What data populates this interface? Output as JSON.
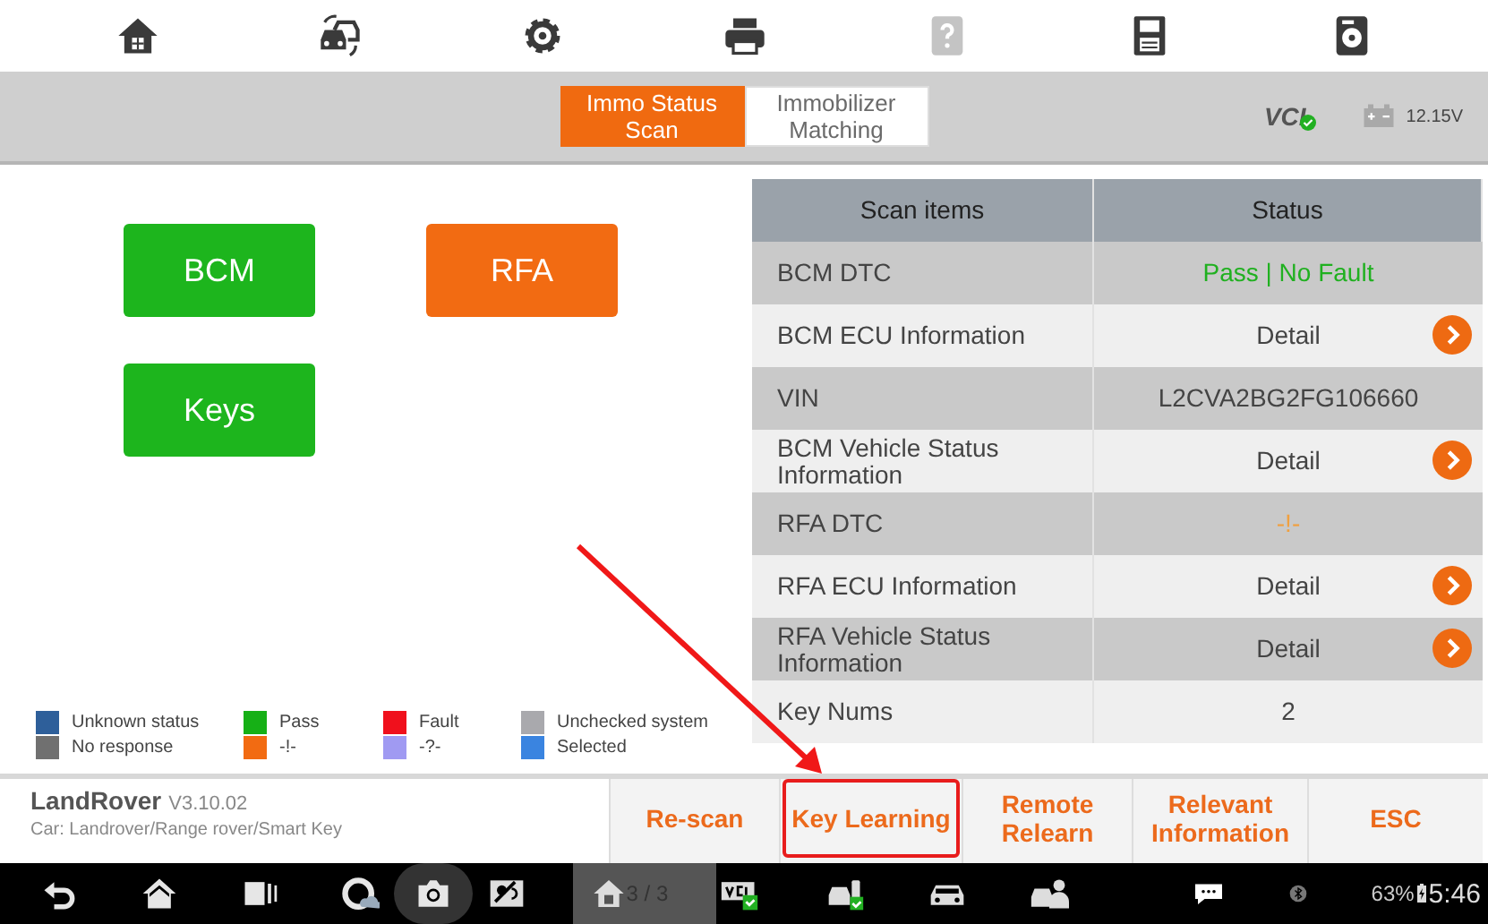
{
  "toolbar": [
    {
      "kind": "home",
      "disabled": false
    },
    {
      "kind": "cars",
      "disabled": false
    },
    {
      "kind": "gear",
      "disabled": false
    },
    {
      "kind": "printer",
      "disabled": false
    },
    {
      "kind": "help",
      "disabled": true
    },
    {
      "kind": "save",
      "disabled": false
    },
    {
      "kind": "disk",
      "disabled": false
    }
  ],
  "tabs": [
    {
      "label": "Immo Status Scan",
      "selected": true
    },
    {
      "label": "Immobilizer Matching",
      "selected": false
    }
  ],
  "vci": {
    "label": "VCI",
    "connected": true
  },
  "battery": {
    "reading": "12.15V"
  },
  "modules": [
    {
      "label": "BCM",
      "color": "#1db51d"
    },
    {
      "label": "RFA",
      "color": "#f26b12"
    },
    {
      "label": "Keys",
      "color": "#1db51d"
    }
  ],
  "legend": [
    {
      "label": "Unknown status",
      "color": "#2e5f9a"
    },
    {
      "label": "Pass",
      "color": "#16b016"
    },
    {
      "label": "Fault",
      "color": "#f0101c"
    },
    {
      "label": "Unchecked system",
      "color": "#a9a9ad"
    },
    {
      "label": "No response",
      "color": "#707070"
    },
    {
      "label": "-!-",
      "color": "#f26b12"
    },
    {
      "label": "-?-",
      "color": "#a09af2"
    },
    {
      "label": "Selected",
      "color": "#3a84e0"
    }
  ],
  "table": {
    "columns": [
      "Scan items",
      "Status"
    ],
    "rows": [
      {
        "item": "BCM DTC",
        "status": "Pass | No Fault",
        "kind": "pass"
      },
      {
        "item": "BCM ECU Information",
        "status": "Detail",
        "kind": "detail"
      },
      {
        "item": "VIN",
        "status": "L2CVA2BG2FG106660",
        "kind": "plain"
      },
      {
        "item": "BCM Vehicle Status Information",
        "status": "Detail",
        "kind": "detail"
      },
      {
        "item": "RFA DTC",
        "status": "-!-",
        "kind": "warning"
      },
      {
        "item": "RFA ECU Information",
        "status": "Detail",
        "kind": "detail"
      },
      {
        "item": "RFA Vehicle Status Information",
        "status": "Detail",
        "kind": "detail"
      },
      {
        "item": "Key Nums",
        "status": "2",
        "kind": "plain"
      }
    ]
  },
  "info": {
    "brand": "LandRover",
    "version": "V3.10.02",
    "car": "Car: Landrover/Range rover/Smart Key"
  },
  "actions": [
    {
      "label": "Re-scan",
      "highlighted": false,
      "arrow": false
    },
    {
      "label": "Key Learning",
      "highlighted": true,
      "arrow": true
    },
    {
      "label": "Remote Relearn",
      "highlighted": false,
      "arrow": false
    },
    {
      "label": "Relevant Information",
      "highlighted": false,
      "arrow": false
    },
    {
      "label": "ESC",
      "highlighted": false,
      "arrow": false
    }
  ],
  "system_bar": {
    "page": "3 / 3",
    "battery": "63%",
    "time": "5:46"
  }
}
